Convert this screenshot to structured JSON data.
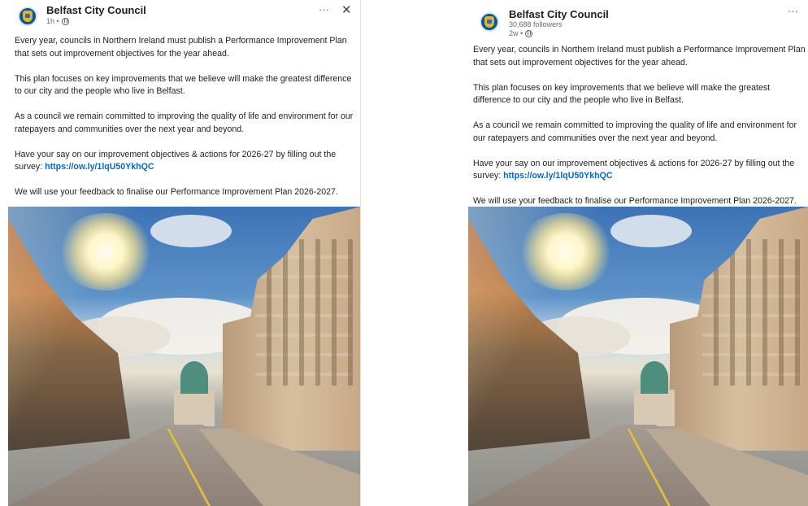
{
  "left_post": {
    "org_name": "Belfast City Council",
    "meta_time": "1h",
    "more_label": "···",
    "close_label": "✕",
    "paragraphs": [
      "Every year, councils in Northern Ireland must publish a Performance Improvement Plan that sets out improvement objectives for the year ahead.",
      "This plan focuses on key improvements that we believe will make the greatest difference to our city and the people who live in Belfast.",
      "As a council we remain committed to improving the quality of life and environment for our ratepayers and communities over the next year and beyond."
    ],
    "survey_text": "Have your say on our improvement objectives & actions for 2026-27 by filling out the survey: ",
    "survey_link": "https://ow.ly/1lqU50YkhQC",
    "closing": "We will use your feedback to finalise our Performance Improvement Plan 2026-2027."
  },
  "right_post": {
    "org_name": "Belfast City Council",
    "followers": "30,688 followers",
    "meta_time": "2w",
    "more_label": "···",
    "paragraphs": [
      "Every year, councils in Northern Ireland must publish a Performance Improvement Plan that sets out improvement objectives for the year ahead.",
      "This plan focuses on key improvements that we believe will make the greatest difference to our city and the people who live in Belfast.",
      "As a council we remain committed to improving the quality of life and environment for our ratepayers and communities over the next year and beyond."
    ],
    "survey_text": "Have your say on our improvement objectives & actions for 2026-27 by filling out the survey: ",
    "survey_link": "https://ow.ly/1lqU50YkhQC",
    "closing": "We will use your feedback to finalise our Performance Improvement Plan 2026-2027."
  },
  "colors": {
    "link": "#0a66c2",
    "text": "#1f1f1f",
    "muted": "#6b6b6b"
  },
  "icons": {
    "avatar": "council-crest-icon",
    "visibility": "globe-icon",
    "more": "ellipsis-icon",
    "close": "close-icon"
  }
}
